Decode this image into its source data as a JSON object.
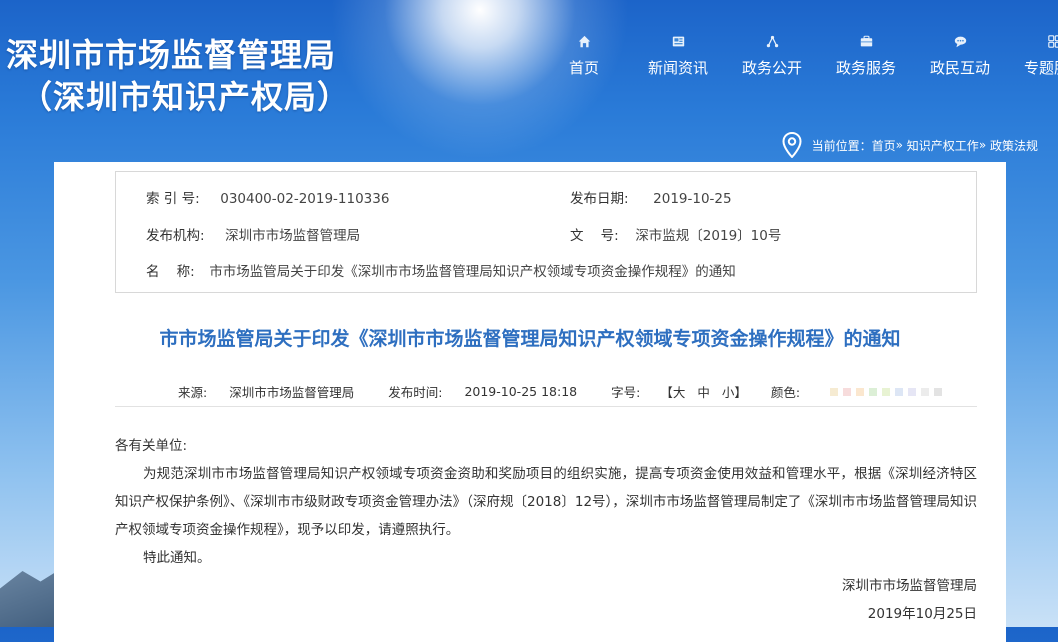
{
  "site": {
    "title_line1": "深圳市市场监督管理局",
    "title_line2": "（深圳市知识产权局）"
  },
  "nav": [
    {
      "label": "首页",
      "icon": "home-icon"
    },
    {
      "label": "新闻资讯",
      "icon": "news-icon"
    },
    {
      "label": "政务公开",
      "icon": "share-icon"
    },
    {
      "label": "政务服务",
      "icon": "briefcase-icon"
    },
    {
      "label": "政民互动",
      "icon": "chat-icon"
    },
    {
      "label": "专题服务",
      "icon": "grid-icon"
    }
  ],
  "breadcrumb": {
    "prefix": "当前位置：",
    "items": [
      "首页",
      "知识产权工作",
      "政策法规"
    ],
    "separator": "»"
  },
  "meta": {
    "index_label": "索 引 号:",
    "index_value": "030400-02-2019-110336",
    "date_label": "发布日期:",
    "date_value": "2019-10-25",
    "org_label": "发布机构:",
    "org_value": "深圳市市场监督管理局",
    "docno_label": "文    号:",
    "docno_value": "深市监规〔2019〕10号",
    "name_label": "名    称:",
    "name_value": "市市场监管局关于印发《深圳市市场监督管理局知识产权领域专项资金操作规程》的通知"
  },
  "article": {
    "title": "市市场监管局关于印发《深圳市市场监督管理局知识产权领域专项资金操作规程》的通知",
    "source_label": "来源:",
    "source_value": "深圳市市场监督管理局",
    "time_label": "发布时间:",
    "time_value": "2019-10-25 18:18",
    "fontsize_label": "字号:",
    "font_open": "【",
    "font_large": "大",
    "font_medium": "中",
    "font_small": "小",
    "font_close": "】",
    "color_label": "颜色:",
    "swatches": [
      "#f6ebd2",
      "#f7dcdc",
      "#fbe7cf",
      "#dcefd6",
      "#e8f3d3",
      "#dde6f5",
      "#e6e6f5",
      "#ececec",
      "#e3e3e3"
    ],
    "greeting": "各有关单位:",
    "paragraph": "为规范深圳市市场监督管理局知识产权领域专项资金资助和奖励项目的组织实施，提高专项资金使用效益和管理水平，根据《深圳经济特区知识产权保护条例》、《深圳市市级财政专项资金管理办法》（深府规〔2018〕12号），深圳市市场监督管理局制定了《深圳市市场监督管理局知识产权领域专项资金操作规程》，现予以印发，请遵照执行。",
    "notice": "特此通知。",
    "signature": "深圳市市场监督管理局",
    "sign_date": "2019年10月25日"
  }
}
